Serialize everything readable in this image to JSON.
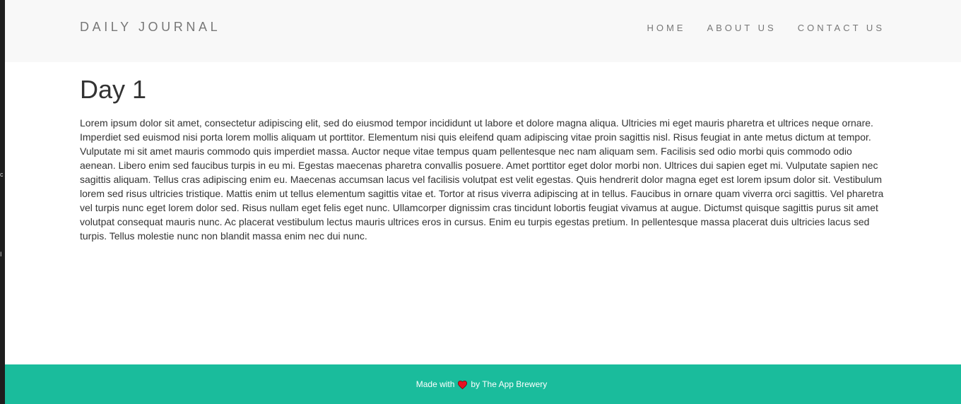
{
  "navbar": {
    "brand": "DAILY JOURNAL",
    "links": [
      "HOME",
      "ABOUT US",
      "CONTACT US"
    ]
  },
  "post": {
    "title": "Day 1",
    "body": "Lorem ipsum dolor sit amet, consectetur adipiscing elit, sed do eiusmod tempor incididunt ut labore et dolore magna aliqua. Ultricies mi eget mauris pharetra et ultrices neque ornare. Imperdiet sed euismod nisi porta lorem mollis aliquam ut porttitor. Elementum nisi quis eleifend quam adipiscing vitae proin sagittis nisl. Risus feugiat in ante metus dictum at tempor. Vulputate mi sit amet mauris commodo quis imperdiet massa. Auctor neque vitae tempus quam pellentesque nec nam aliquam sem. Facilisis sed odio morbi quis commodo odio aenean. Libero enim sed faucibus turpis in eu mi. Egestas maecenas pharetra convallis posuere. Amet porttitor eget dolor morbi non. Ultrices dui sapien eget mi. Vulputate sapien nec sagittis aliquam. Tellus cras adipiscing enim eu. Maecenas accumsan lacus vel facilisis volutpat est velit egestas. Quis hendrerit dolor magna eget est lorem ipsum dolor sit. Vestibulum lorem sed risus ultricies tristique. Mattis enim ut tellus elementum sagittis vitae et. Tortor at risus viverra adipiscing at in tellus. Faucibus in ornare quam viverra orci sagittis. Vel pharetra vel turpis nunc eget lorem dolor sed. Risus nullam eget felis eget nunc. Ullamcorper dignissim cras tincidunt lobortis feugiat vivamus at augue. Dictumst quisque sagittis purus sit amet volutpat consequat mauris nunc. Ac placerat vestibulum lectus mauris ultrices eros in cursus. Enim eu turpis egestas pretium. In pellentesque massa placerat duis ultricies lacus sed turpis. Tellus molestie nunc non blandit massa enim nec dui nunc."
  },
  "footer": {
    "made_with": "Made with",
    "icon": "heart-icon",
    "by": "by The App Brewery"
  },
  "left_strip": {
    "glyphs": [
      "c",
      "I"
    ]
  },
  "colors": {
    "navbar_bg": "#f8f8f8",
    "nav_text": "#777777",
    "body_text": "#333333",
    "footer_bg": "#1abc9c",
    "heart": "#e81123"
  }
}
